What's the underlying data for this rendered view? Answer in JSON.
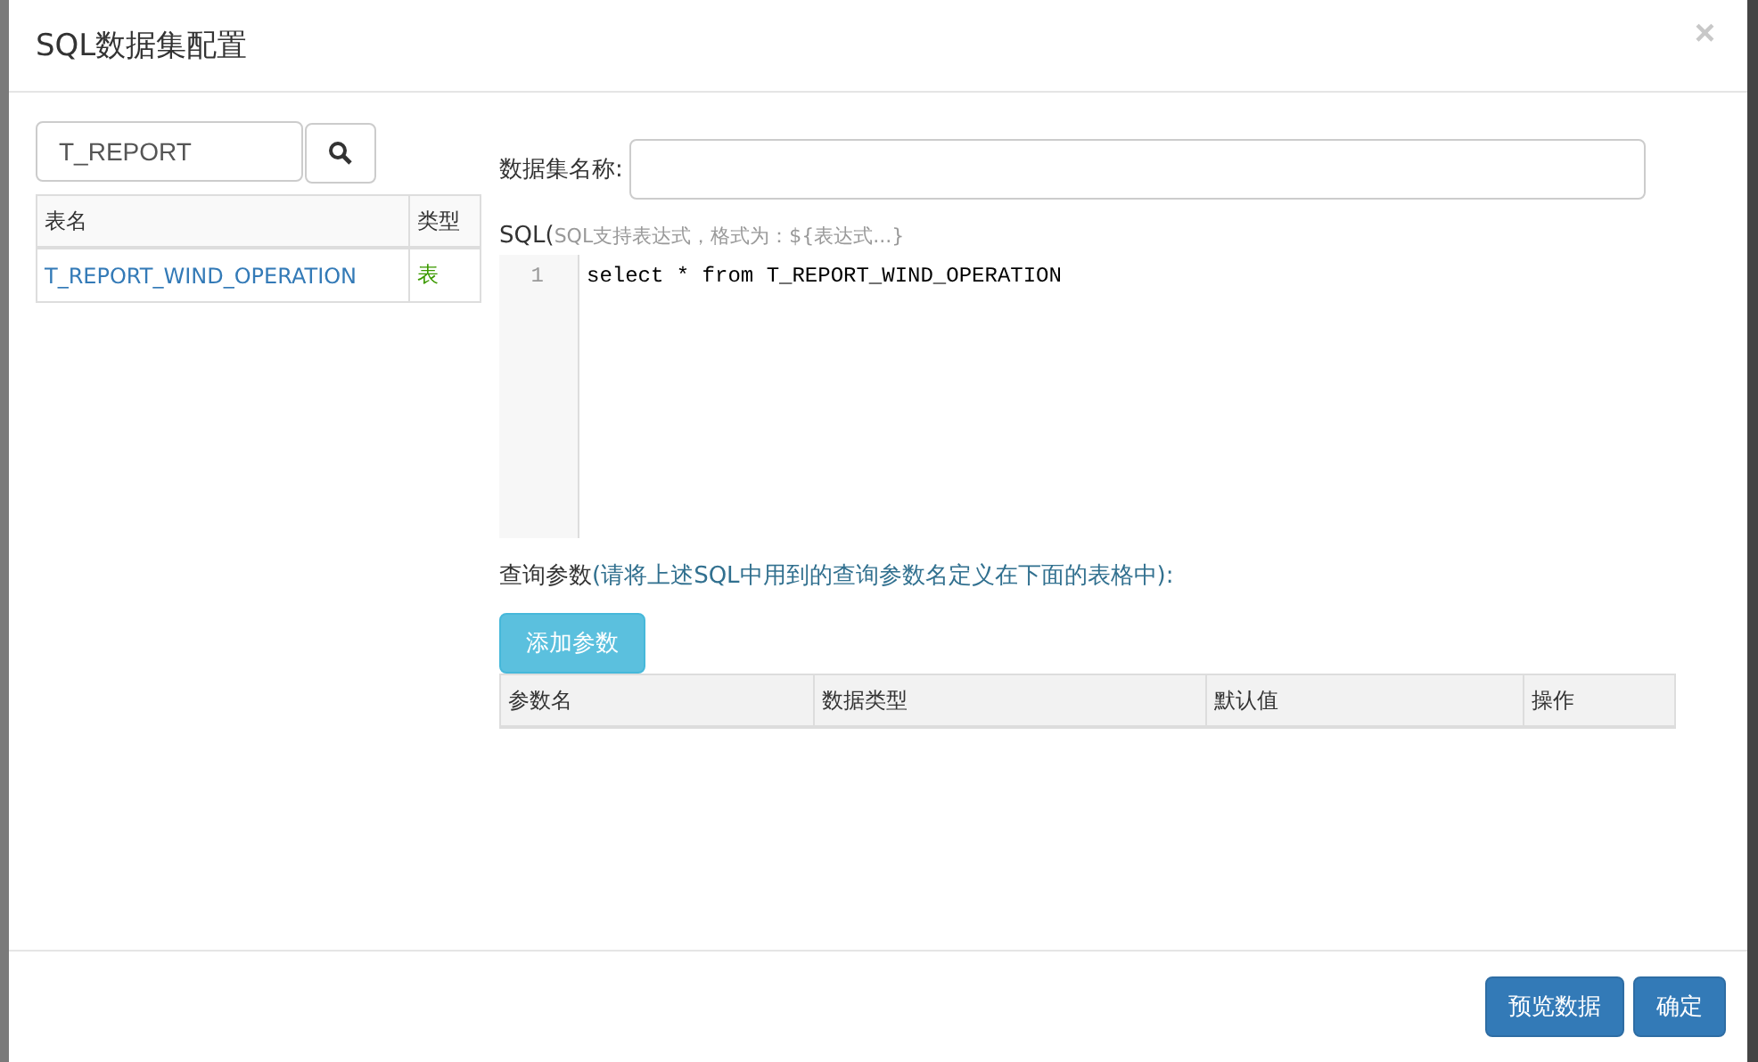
{
  "dialog": {
    "title": "SQL数据集配置",
    "close": "×"
  },
  "table_search": {
    "value": "T_REPORT"
  },
  "table_list": {
    "columns": [
      "表名",
      "类型"
    ],
    "rows": [
      {
        "name": "T_REPORT_WIND_OPERATION",
        "type": "表"
      }
    ]
  },
  "dataset_name": {
    "label": "数据集名称:"
  },
  "sql": {
    "label": "SQL(",
    "hint": "SQL支持表达式，格式为：${表达式...}",
    "lines": [
      {
        "number": "1",
        "code": "select * from T_REPORT_WIND_OPERATION"
      }
    ]
  },
  "query_params": {
    "label": "查询参数",
    "hint": "(请将上述SQL中用到的查询参数名定义在下面的表格中):",
    "add_button": "添加参数",
    "columns": [
      "参数名",
      "数据类型",
      "默认值",
      "操作"
    ]
  },
  "footer_buttons": [
    "预览数据",
    "确定"
  ]
}
